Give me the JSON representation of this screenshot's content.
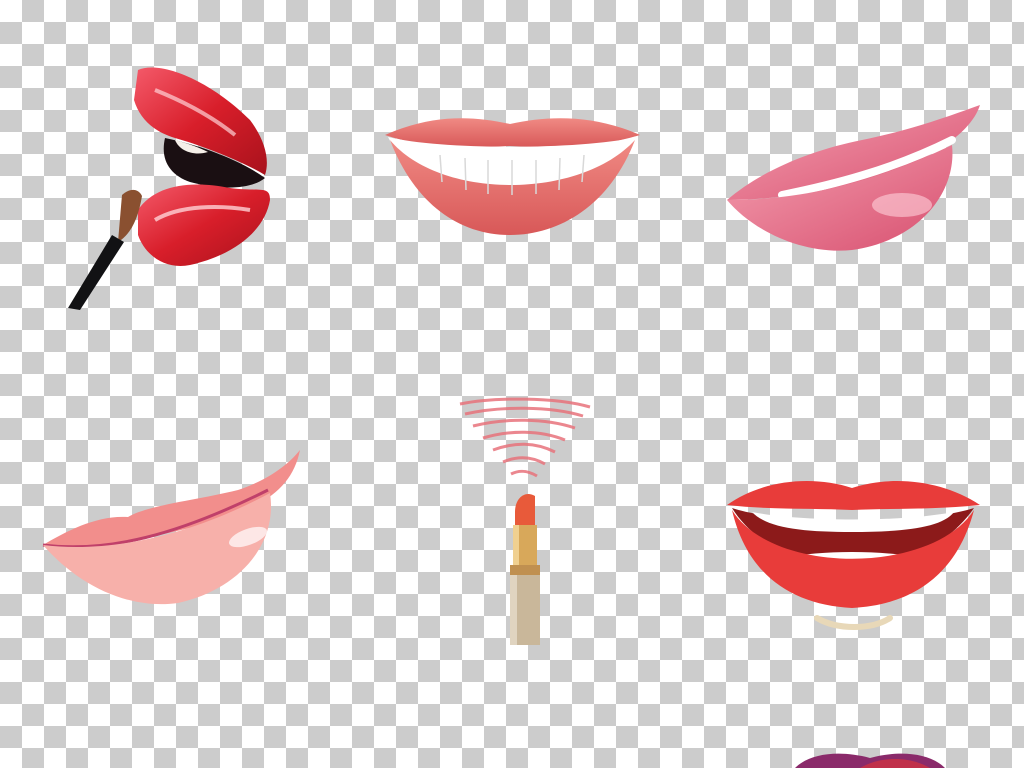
{
  "background": {
    "pattern": "transparency-checkerboard",
    "light_color": "#ffffff",
    "dark_color": "#cccccc"
  },
  "illustrations": [
    {
      "name": "glossy-lips-with-brush",
      "colors": [
        "#d8242c",
        "#f0576a",
        "#1a0f12"
      ]
    },
    {
      "name": "smiling-lips-with-teeth",
      "colors": [
        "#e8706e",
        "#ffffff"
      ]
    },
    {
      "name": "pink-side-lips",
      "colors": [
        "#e06a80",
        "#f4a0b0"
      ]
    },
    {
      "name": "cartoon-pink-lips",
      "colors": [
        "#f08a8a",
        "#f7b3ae"
      ]
    },
    {
      "name": "lipstick-with-swatch",
      "colors": [
        "#e8737c",
        "#d8a85a",
        "#c9b79a"
      ]
    },
    {
      "name": "cartoon-red-smile",
      "colors": [
        "#e83c3a",
        "#ffffff",
        "#e8d8b8"
      ]
    },
    {
      "name": "partial-purple-lips",
      "colors": [
        "#8a2a6a",
        "#c0304a"
      ]
    }
  ]
}
